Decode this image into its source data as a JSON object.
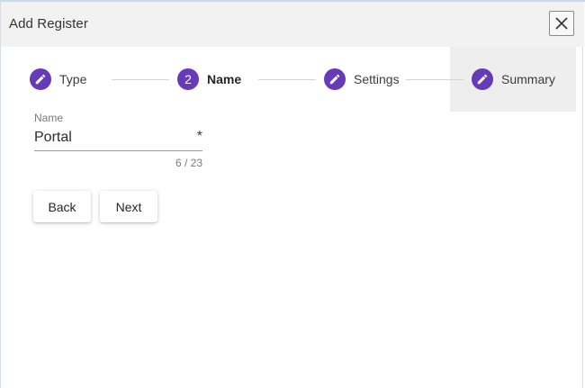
{
  "dialog": {
    "title": "Add Register",
    "close_icon": "close-icon"
  },
  "stepper": {
    "accent_color": "#673ab7",
    "steps": [
      {
        "label": "Type",
        "icon": "pencil-icon",
        "state": "completed"
      },
      {
        "label": "Name",
        "number": "2",
        "state": "active"
      },
      {
        "label": "Settings",
        "icon": "pencil-icon",
        "state": "editable"
      },
      {
        "label": "Summary",
        "icon": "pencil-icon",
        "state": "editable"
      }
    ]
  },
  "form": {
    "name_label": "Name",
    "name_value": "Portal",
    "required_marker": "*",
    "char_counter": "6 / 23"
  },
  "actions": {
    "back_label": "Back",
    "next_label": "Next"
  }
}
